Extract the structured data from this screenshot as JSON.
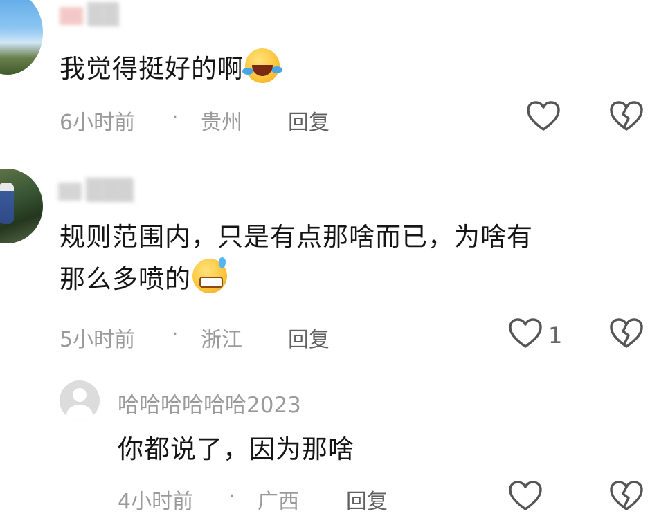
{
  "comments": [
    {
      "author": "",
      "text": "我觉得挺好的啊",
      "emoji": "rofl-emoji",
      "time": "6小时前",
      "separator": "·",
      "location": "贵州",
      "reply_label": "回复",
      "like_count": ""
    },
    {
      "author": "",
      "text_line1": "规则范围内，只是有点那啥而已，为啥有",
      "text_line2": "那么多喷的",
      "emoji": "grin-sweat-emoji",
      "time": "5小时前",
      "separator": "·",
      "location": "浙江",
      "reply_label": "回复",
      "like_count": "1"
    }
  ],
  "reply": {
    "author": "哈哈哈哈哈哈2023",
    "text": "你都说了，因为那啥",
    "time": "4小时前",
    "separator": "·",
    "location": "广西",
    "reply_label": "回复"
  },
  "icons": {
    "like": "heart-icon",
    "dislike": "broken-heart-icon"
  },
  "colors": {
    "meta_text": "#9a9a9a",
    "body_text": "#151515",
    "icon_stroke": "#555555"
  }
}
